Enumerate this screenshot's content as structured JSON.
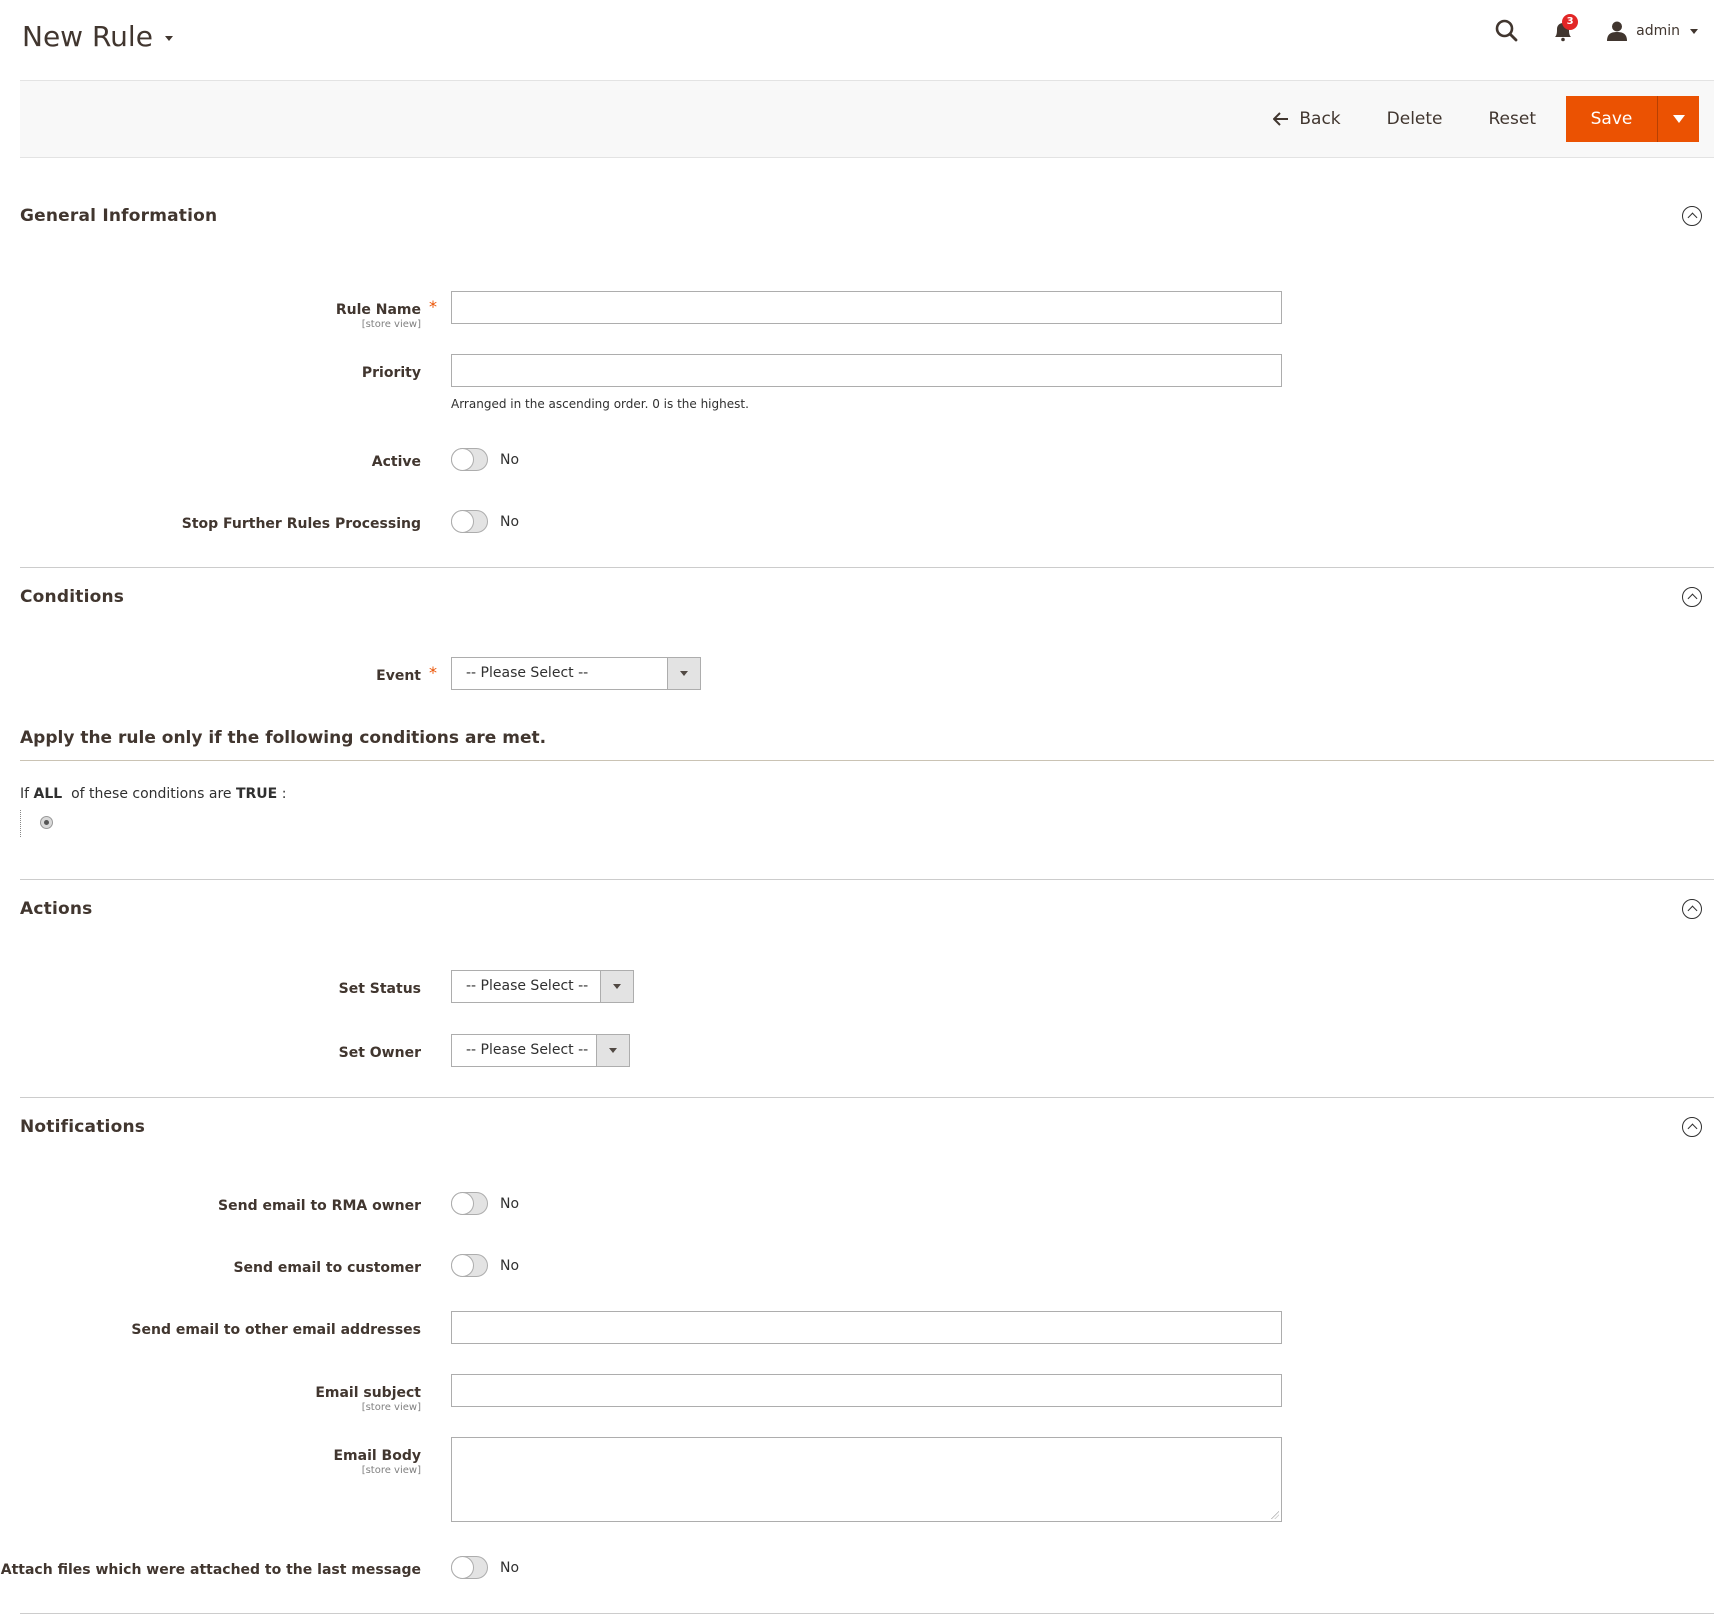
{
  "header": {
    "title": "New Rule",
    "notifications_count": "3",
    "user_name": "admin"
  },
  "toolbar": {
    "back_label": "Back",
    "delete_label": "Delete",
    "reset_label": "Reset",
    "save_label": "Save"
  },
  "colors": {
    "accent": "#eb5202",
    "badge": "#e22626"
  },
  "sections": {
    "general": {
      "title": "General Information",
      "rule_name_label": "Rule Name",
      "rule_name_scope": "[store view]",
      "rule_name_value": "",
      "priority_label": "Priority",
      "priority_value": "",
      "priority_note": "Arranged in the ascending order. 0 is the highest.",
      "active_label": "Active",
      "active_value": "No",
      "stop_label": "Stop Further Rules Processing",
      "stop_value": "No"
    },
    "conditions": {
      "title": "Conditions",
      "event_label": "Event",
      "event_value": "-- Please Select --",
      "apply_heading": "Apply the rule only if the following conditions are met.",
      "if_text": "If",
      "aggregator": "ALL",
      "middle_text": "of these conditions are",
      "value": "TRUE",
      "colon": ":"
    },
    "actions": {
      "title": "Actions",
      "set_status_label": "Set Status",
      "set_status_value": "-- Please Select --",
      "set_owner_label": "Set Owner",
      "set_owner_value": "-- Please Select --"
    },
    "notifications": {
      "title": "Notifications",
      "rma_owner_label": "Send email to RMA owner",
      "rma_owner_value": "No",
      "customer_label": "Send email to customer",
      "customer_value": "No",
      "other_emails_label": "Send email to other email addresses",
      "other_emails_value": "",
      "subject_label": "Email subject",
      "subject_scope": "[store view]",
      "subject_value": "",
      "body_label": "Email Body",
      "body_scope": "[store view]",
      "body_value": "",
      "attach_label": "Attach files which were attached to the last message",
      "attach_value": "No"
    }
  }
}
